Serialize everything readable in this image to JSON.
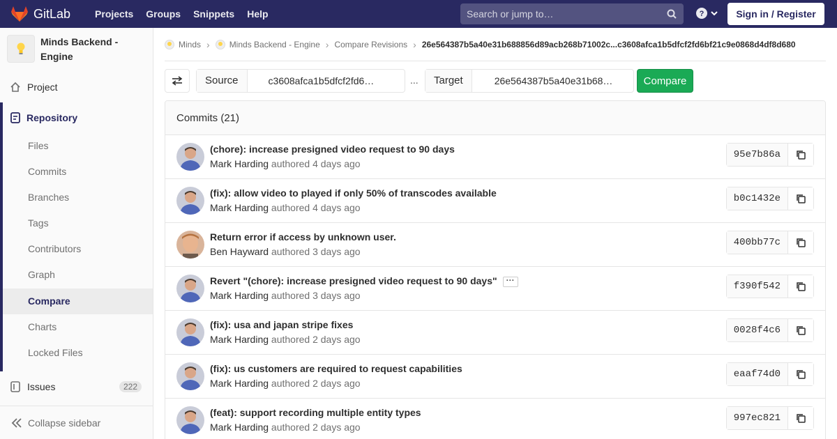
{
  "navbar": {
    "brand": "GitLab",
    "links": [
      "Projects",
      "Groups",
      "Snippets",
      "Help"
    ],
    "search_placeholder": "Search or jump to…",
    "signin": "Sign in / Register",
    "bg_color": "#292961"
  },
  "sidebar": {
    "project_name": "Minds Backend - Engine",
    "project_item": "Project",
    "repository": "Repository",
    "repo_items": [
      "Files",
      "Commits",
      "Branches",
      "Tags",
      "Contributors",
      "Graph",
      "Compare",
      "Charts",
      "Locked Files"
    ],
    "active_item": "Compare",
    "issues_label": "Issues",
    "issues_count": "222",
    "collapse": "Collapse sidebar"
  },
  "breadcrumb": {
    "items": [
      "Minds",
      "Minds Backend - Engine",
      "Compare Revisions"
    ],
    "current": "26e564387b5a40e31b688856d89acb268b71002c...c3608afca1b5dfcf2fd6bf21c9e0868d4df8d680"
  },
  "compare": {
    "source_label": "Source",
    "source_value": "c3608afca1b5dfcf2fd6…",
    "dots": "...",
    "target_label": "Target",
    "target_value": "26e564387b5a40e31b68…",
    "button": "Compare",
    "button_color": "#1aaa55"
  },
  "commits": {
    "header": "Commits (21)",
    "items": [
      {
        "title": "(chore): increase presigned video request to 90 days",
        "author": "Mark Harding",
        "when": "authored 4 days ago",
        "sha": "95e7b86a",
        "avatar": "mark",
        "more": false
      },
      {
        "title": "(fix): allow video to played if only 50% of transcodes available",
        "author": "Mark Harding",
        "when": "authored 4 days ago",
        "sha": "b0c1432e",
        "avatar": "mark",
        "more": false
      },
      {
        "title": "Return error if access by unknown user.",
        "author": "Ben Hayward",
        "when": "authored 3 days ago",
        "sha": "400bb77c",
        "avatar": "ben",
        "more": false
      },
      {
        "title": "Revert \"(chore): increase presigned video request to 90 days\"",
        "author": "Mark Harding",
        "when": "authored 3 days ago",
        "sha": "f390f542",
        "avatar": "mark",
        "more": true
      },
      {
        "title": "(fix): usa and japan stripe fixes",
        "author": "Mark Harding",
        "when": "authored 2 days ago",
        "sha": "0028f4c6",
        "avatar": "mark",
        "more": false
      },
      {
        "title": "(fix): us customers are required to request capabilities",
        "author": "Mark Harding",
        "when": "authored 2 days ago",
        "sha": "eaaf74d0",
        "avatar": "mark",
        "more": false
      },
      {
        "title": "(feat): support recording multiple entity types",
        "author": "Mark Harding",
        "when": "authored 2 days ago",
        "sha": "997ec821",
        "avatar": "mark",
        "more": false
      }
    ]
  }
}
